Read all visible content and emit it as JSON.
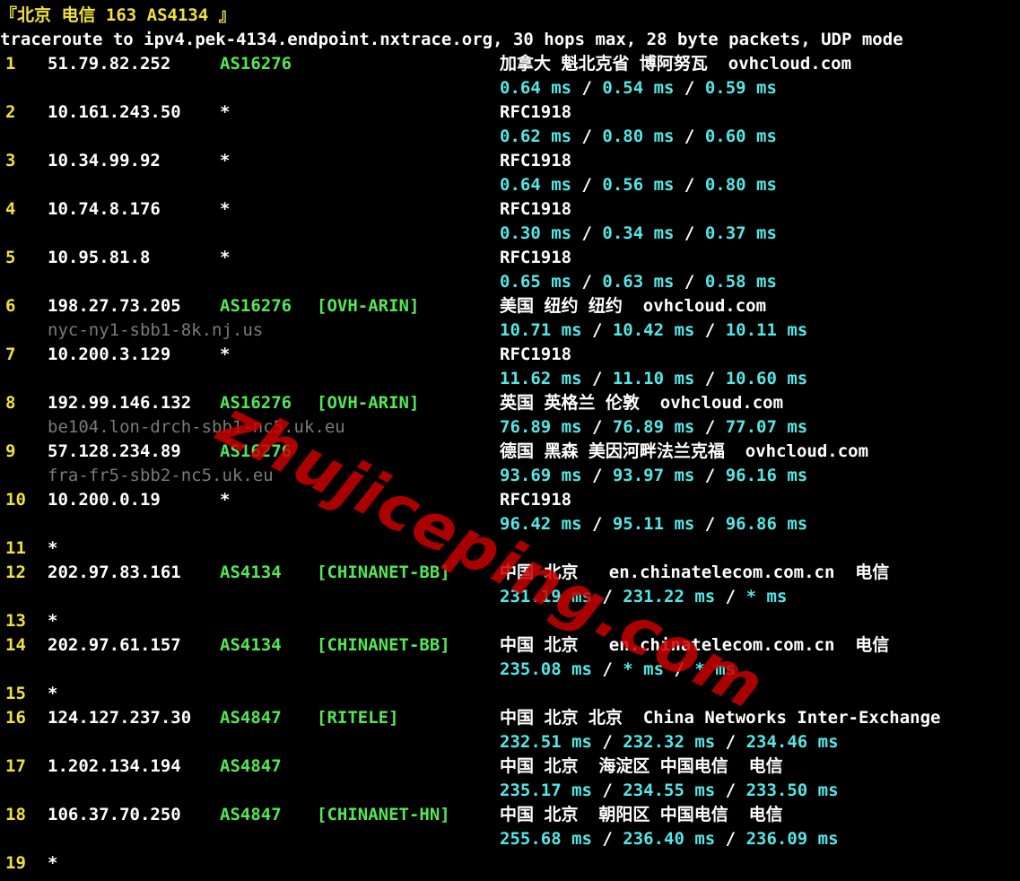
{
  "header": {
    "title": "『北京 电信 163 AS4134 』",
    "command": "traceroute to ipv4.pek-4134.endpoint.nxtrace.org, 30 hops max, 28 byte packets, UDP mode"
  },
  "hops": [
    {
      "num": "1",
      "ip": "51.79.82.252",
      "asn": "AS16276",
      "tag": "",
      "loc": "加拿大 魁北克省 博阿努瓦  ovhcloud.com",
      "ptr": "",
      "times": [
        "0.64 ms",
        "0.54 ms",
        "0.59 ms"
      ]
    },
    {
      "num": "2",
      "ip": "10.161.243.50",
      "asn": "*",
      "tag": "",
      "loc": "RFC1918",
      "ptr": "",
      "times": [
        "0.62 ms",
        "0.80 ms",
        "0.60 ms"
      ]
    },
    {
      "num": "3",
      "ip": "10.34.99.92",
      "asn": "*",
      "tag": "",
      "loc": "RFC1918",
      "ptr": "",
      "times": [
        "0.64 ms",
        "0.56 ms",
        "0.80 ms"
      ]
    },
    {
      "num": "4",
      "ip": "10.74.8.176",
      "asn": "*",
      "tag": "",
      "loc": "RFC1918",
      "ptr": "",
      "times": [
        "0.30 ms",
        "0.34 ms",
        "0.37 ms"
      ]
    },
    {
      "num": "5",
      "ip": "10.95.81.8",
      "asn": "*",
      "tag": "",
      "loc": "RFC1918",
      "ptr": "",
      "times": [
        "0.65 ms",
        "0.63 ms",
        "0.58 ms"
      ]
    },
    {
      "num": "6",
      "ip": "198.27.73.205",
      "asn": "AS16276",
      "tag": "[OVH-ARIN]",
      "loc": "美国 纽约 纽约  ovhcloud.com",
      "ptr": "nyc-ny1-sbb1-8k.nj.us",
      "times": [
        "10.71 ms",
        "10.42 ms",
        "10.11 ms"
      ]
    },
    {
      "num": "7",
      "ip": "10.200.3.129",
      "asn": "*",
      "tag": "",
      "loc": "RFC1918",
      "ptr": "",
      "times": [
        "11.62 ms",
        "11.10 ms",
        "10.60 ms"
      ]
    },
    {
      "num": "8",
      "ip": "192.99.146.132",
      "asn": "AS16276",
      "tag": "[OVH-ARIN]",
      "loc": "英国 英格兰 伦敦  ovhcloud.com",
      "ptr": "be104.lon-drch-sbb1-nc5.uk.eu",
      "times": [
        "76.89 ms",
        "76.89 ms",
        "77.07 ms"
      ]
    },
    {
      "num": "9",
      "ip": "57.128.234.89",
      "asn": "AS16276",
      "tag": "",
      "loc": "德国 黑森 美因河畔法兰克福  ovhcloud.com",
      "ptr": "fra-fr5-sbb2-nc5.uk.eu",
      "times": [
        "93.69 ms",
        "93.97 ms",
        "96.16 ms"
      ]
    },
    {
      "num": "10",
      "ip": "10.200.0.19",
      "asn": "*",
      "tag": "",
      "loc": "RFC1918",
      "ptr": "",
      "times": [
        "96.42 ms",
        "95.11 ms",
        "96.86 ms"
      ]
    },
    {
      "num": "11",
      "ip": "*",
      "asn": "",
      "tag": "",
      "loc": "",
      "ptr": "",
      "times": []
    },
    {
      "num": "12",
      "ip": "202.97.83.161",
      "asn": "AS4134",
      "tag": "[CHINANET-BB]",
      "loc": "中国 北京   en.chinatelecom.com.cn  电信",
      "ptr": "",
      "times": [
        "231.19 ms",
        "231.22 ms",
        "* ms"
      ]
    },
    {
      "num": "13",
      "ip": "*",
      "asn": "",
      "tag": "",
      "loc": "",
      "ptr": "",
      "times": []
    },
    {
      "num": "14",
      "ip": "202.97.61.157",
      "asn": "AS4134",
      "tag": "[CHINANET-BB]",
      "loc": "中国 北京   en.chinatelecom.com.cn  电信",
      "ptr": "",
      "times": [
        "235.08 ms",
        "* ms",
        "* ms"
      ]
    },
    {
      "num": "15",
      "ip": "*",
      "asn": "",
      "tag": "",
      "loc": "",
      "ptr": "",
      "times": []
    },
    {
      "num": "16",
      "ip": "124.127.237.30",
      "asn": "AS4847",
      "tag": "[RITELE]",
      "loc": "中国 北京 北京  China Networks Inter-Exchange",
      "ptr": "",
      "times": [
        "232.51 ms",
        "232.32 ms",
        "234.46 ms"
      ]
    },
    {
      "num": "17",
      "ip": "1.202.134.194",
      "asn": "AS4847",
      "tag": "",
      "loc": "中国 北京  海淀区 中国电信  电信",
      "ptr": "",
      "times": [
        "235.17 ms",
        "234.55 ms",
        "233.50 ms"
      ]
    },
    {
      "num": "18",
      "ip": "106.37.70.250",
      "asn": "AS4847",
      "tag": "[CHINANET-HN]",
      "loc": "中国 北京  朝阳区 中国电信  电信",
      "ptr": "",
      "times": [
        "255.68 ms",
        "236.40 ms",
        "236.09 ms"
      ]
    },
    {
      "num": "19",
      "ip": "*",
      "asn": "",
      "tag": "",
      "loc": "",
      "ptr": "",
      "times": []
    }
  ],
  "time_separator": " / ",
  "watermark": "zhujiceping.com",
  "colors": {
    "hop_number": "#f0e040",
    "asn": "#55e655",
    "latency": "#55e6e6",
    "ptr": "#7a7a7a",
    "watermark": "#c80000"
  }
}
